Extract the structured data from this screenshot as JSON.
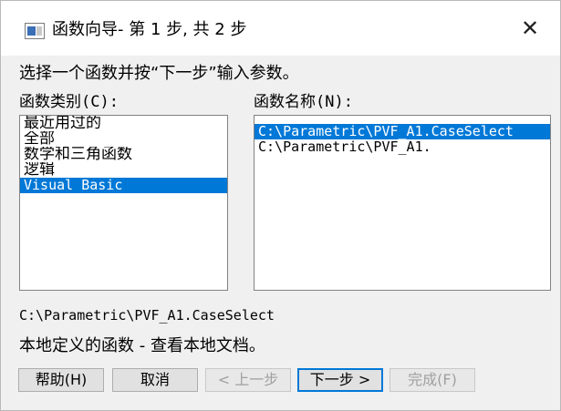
{
  "window": {
    "title": "函数向导- 第 1 步, 共 2 步",
    "close_symbol": "✕"
  },
  "prompt": "选择一个函数并按“下一步”输入参数。",
  "categories": {
    "label": "函数类别(C):",
    "items": [
      {
        "label": "最近用过的",
        "selected": false
      },
      {
        "label": "全部",
        "selected": false
      },
      {
        "label": "数学和三角函数",
        "selected": false
      },
      {
        "label": "逻辑",
        "selected": false
      },
      {
        "label": "Visual Basic",
        "selected": true
      }
    ]
  },
  "functions": {
    "label": "函数名称(N):",
    "items": [
      {
        "label": "C:\\Parametric\\PVF_A1.CaseSelect",
        "selected": true
      },
      {
        "label": "C:\\Parametric\\PVF_A1.",
        "selected": false
      }
    ]
  },
  "selected_function": "C:\\Parametric\\PVF_A1.CaseSelect",
  "description": "本地定义的函数 - 查看本地文档。",
  "buttons": {
    "help": "帮助(H)",
    "cancel": "取消",
    "back": "< 上一步",
    "next": "下一步 >",
    "finish": "完成(F)"
  },
  "colors": {
    "selection": "#0078d7",
    "dialog_bg": "#f0f0f0"
  }
}
